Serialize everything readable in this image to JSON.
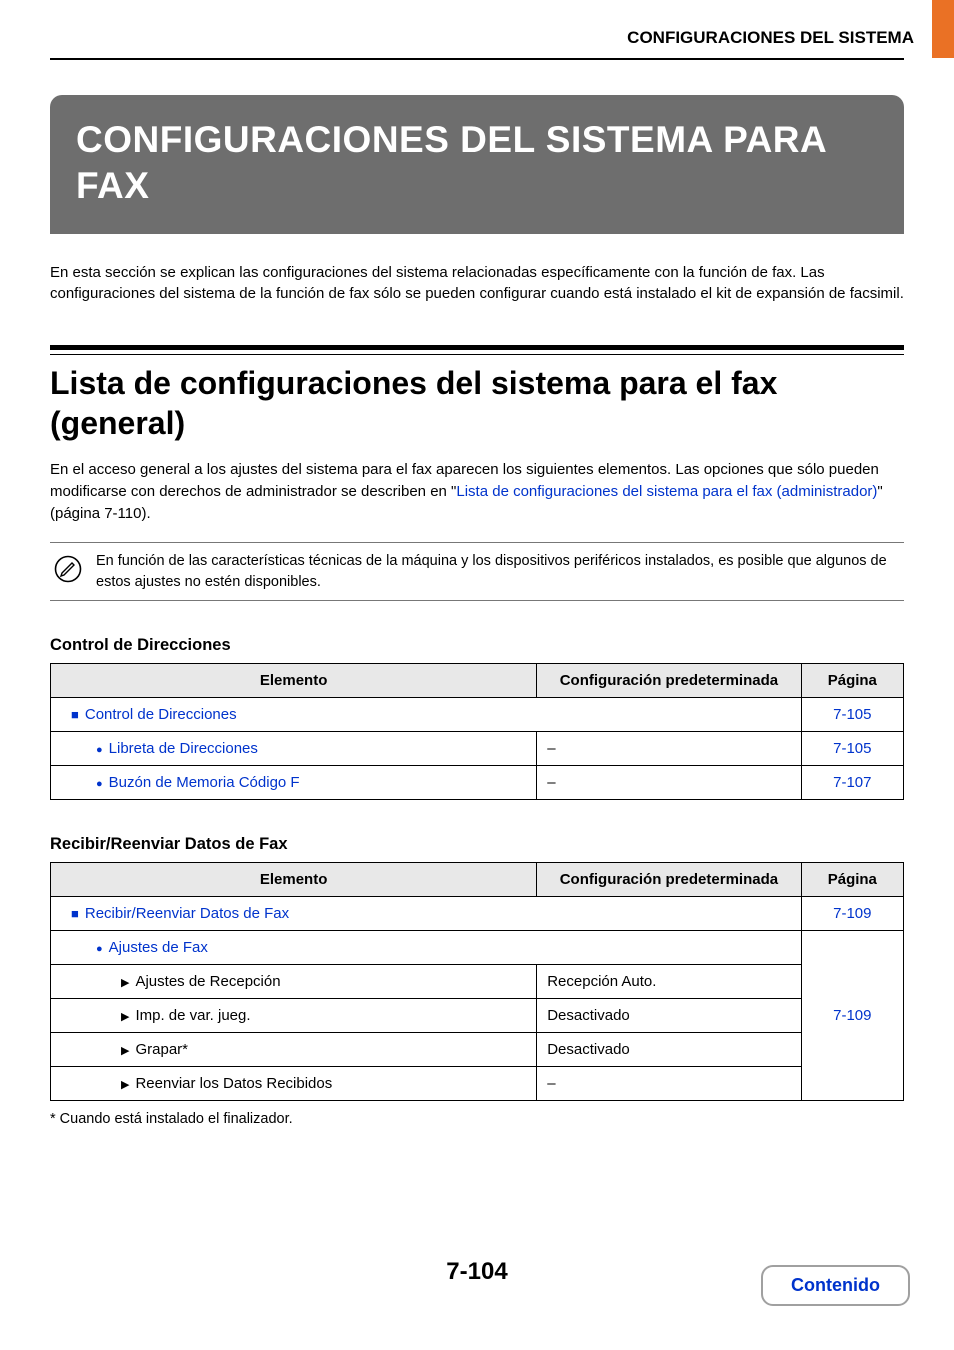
{
  "header": {
    "breadcrumb": "CONFIGURACIONES DEL SISTEMA"
  },
  "banner": {
    "title": "CONFIGURACIONES DEL SISTEMA PARA FAX"
  },
  "intro": "En esta sección se explican las configuraciones del sistema relacionadas específicamente con la función de fax. Las configuraciones del sistema de la función de fax sólo se pueden configurar cuando está instalado el kit de expansión de facsimil.",
  "section": {
    "title": "Lista de configuraciones del sistema para el fax (general)",
    "desc_before_link": "En el acceso general a los ajustes del sistema para el fax aparecen los siguientes elementos. Las opciones que sólo pueden modificarse con derechos de administrador se describen en \"",
    "link_text": "Lista de configuraciones del sistema para el fax (administrador)",
    "desc_after_link": "\" (página 7-110)."
  },
  "note": "En función de las características técnicas de la máquina y los dispositivos periféricos instalados, es posible que algunos de estos ajustes no estén disponibles.",
  "table_headers": {
    "element": "Elemento",
    "config": "Configuración predeterminada",
    "page": "Página"
  },
  "table1": {
    "title": "Control de Direcciones",
    "rows": [
      {
        "label": "Control de Direcciones",
        "config": "",
        "page": "7-105",
        "marker": "square",
        "indent": 1,
        "blue": true,
        "span": true
      },
      {
        "label": "Libreta de Direcciones",
        "config": "–",
        "page": "7-105",
        "marker": "bullet",
        "indent": 2,
        "blue": true
      },
      {
        "label": "Buzón de Memoria Código F",
        "config": "–",
        "page": "7-107",
        "marker": "bullet",
        "indent": 2,
        "blue": true
      }
    ]
  },
  "table2": {
    "title": "Recibir/Reenviar Datos de Fax",
    "rows": [
      {
        "label": "Recibir/Reenviar Datos de Fax",
        "config": "",
        "page": "7-109",
        "marker": "square",
        "indent": 1,
        "blue": true,
        "span": true
      },
      {
        "label": "Ajustes de Fax",
        "config": "",
        "page": "",
        "marker": "bullet",
        "indent": 2,
        "blue": true,
        "nocfg": true
      },
      {
        "label": "Ajustes de Recepción",
        "config": "Recepción Auto.",
        "page": "",
        "marker": "triangle",
        "indent": 3
      },
      {
        "label": "Imp. de var. jueg.",
        "config": "Desactivado",
        "page": "7-109",
        "marker": "triangle",
        "indent": 3
      },
      {
        "label": "Grapar*",
        "config": "Desactivado",
        "page": "",
        "marker": "triangle",
        "indent": 3
      },
      {
        "label": "Reenviar los Datos Recibidos",
        "config": "–",
        "page": "",
        "marker": "triangle",
        "indent": 3
      }
    ],
    "footnote": "*  Cuando está instalado el finalizador."
  },
  "footer": {
    "page_number": "7-104",
    "contents_label": "Contenido"
  }
}
